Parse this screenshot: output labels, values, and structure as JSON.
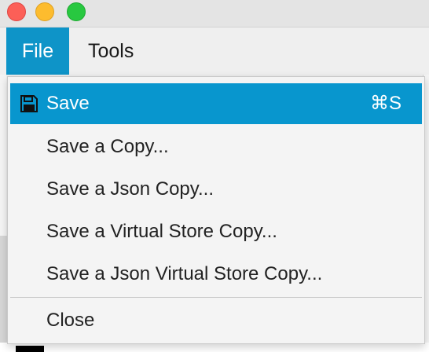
{
  "menubar": {
    "items": [
      {
        "label": "File"
      },
      {
        "label": "Tools"
      }
    ]
  },
  "file_menu": {
    "items": [
      {
        "label": "Save",
        "shortcut": "⌘S",
        "icon": "save-icon",
        "selected": true
      },
      {
        "label": "Save a Copy..."
      },
      {
        "label": "Save a Json Copy..."
      },
      {
        "label": "Save a Virtual Store Copy..."
      },
      {
        "label": "Save a Json Virtual Store Copy..."
      },
      {
        "label": "Close"
      }
    ]
  },
  "colors": {
    "accent": "#0896ce",
    "menu_background": "#f4f4f4",
    "close_button": "#fc5f57",
    "minimize_button": "#fdbc2e",
    "zoom_button": "#28c840"
  }
}
